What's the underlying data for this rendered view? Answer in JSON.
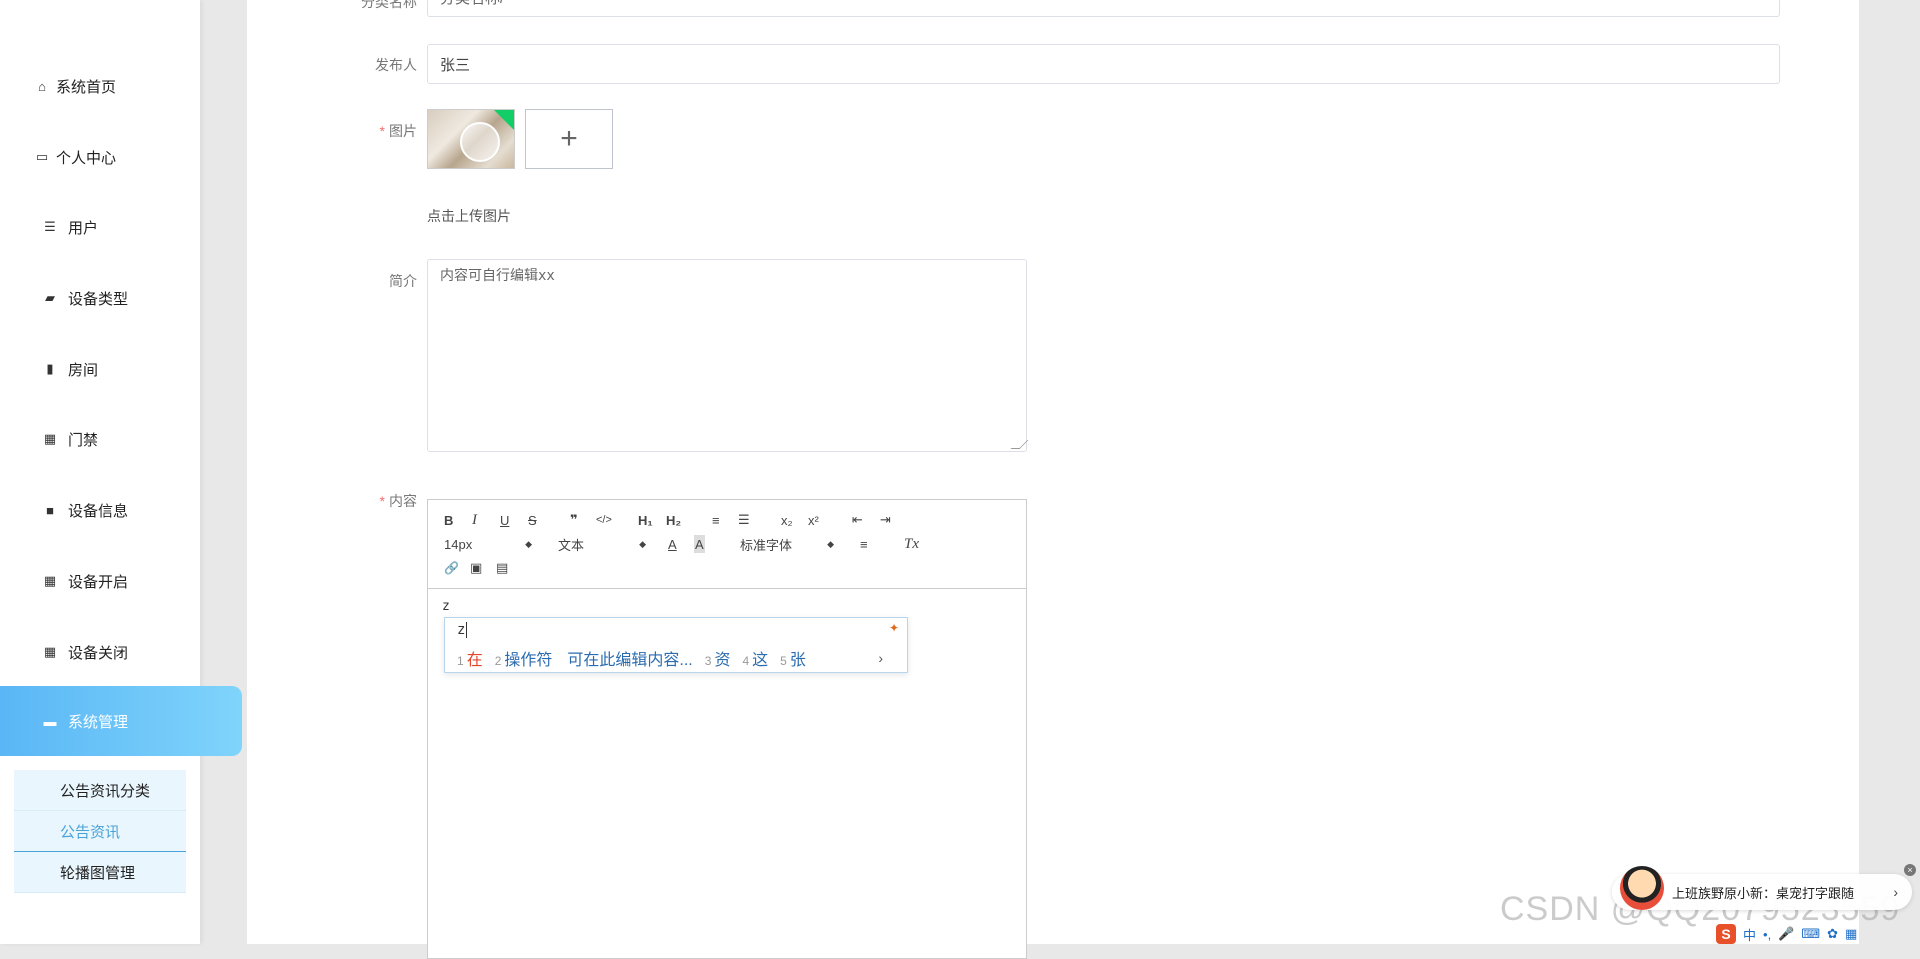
{
  "sidebar": {
    "items": [
      {
        "label": "系统首页",
        "icon": "home-icon"
      },
      {
        "label": "个人中心",
        "icon": "card-icon"
      },
      {
        "label": "用户",
        "icon": "list-icon"
      },
      {
        "label": "设备类型",
        "icon": "chair-icon"
      },
      {
        "label": "房间",
        "icon": "bar-chart-icon"
      },
      {
        "label": "门禁",
        "icon": "grid-icon"
      },
      {
        "label": "设备信息",
        "icon": "briefcase-icon"
      },
      {
        "label": "设备开启",
        "icon": "grid-icon"
      },
      {
        "label": "设备关闭",
        "icon": "grid-icon"
      },
      {
        "label": "系统管理",
        "icon": "ticket-icon"
      }
    ],
    "submenu": [
      {
        "label": "公告资讯分类"
      },
      {
        "label": "公告资讯"
      },
      {
        "label": "轮播图管理"
      }
    ]
  },
  "form": {
    "category": {
      "label": "分类名称",
      "value": "分类名称/"
    },
    "publisher": {
      "label": "发布人",
      "value": "张三"
    },
    "image": {
      "label": "图片",
      "required": "*",
      "upload_plus": "+",
      "hint": "点击上传图片"
    },
    "intro": {
      "label": "简介",
      "value": "内容可自行编辑xx"
    },
    "content": {
      "label": "内容",
      "required": "*",
      "toolbar": {
        "bold": "B",
        "italic": "I",
        "underline": "U",
        "strike": "S",
        "quote": "❞",
        "code": "</>",
        "h1": "H₁",
        "h2": "H₂",
        "ordered_list": "≡",
        "bullet_list": "☰",
        "subscript": "x₂",
        "superscript": "x²",
        "outdent": "⇤",
        "indent": "⇥",
        "size": "14px",
        "header": "文本",
        "font": "标准字体",
        "color": "A",
        "background": "A",
        "align": "≡",
        "clean": "Tx",
        "link": "🔗",
        "image": "▣",
        "video": "▤"
      },
      "typed": "z"
    }
  },
  "ime": {
    "input": "z",
    "candidates": [
      {
        "n": "1",
        "text": "在"
      },
      {
        "n": "2",
        "text": "操作符"
      },
      {
        "n": "",
        "text": "可在此编辑内容..."
      },
      {
        "n": "3",
        "text": "资"
      },
      {
        "n": "4",
        "text": "这"
      },
      {
        "n": "5",
        "text": "张"
      }
    ],
    "next": "›"
  },
  "toast": {
    "text": "上班族野原小新：桌宠打字跟随",
    "chevron": "›",
    "close": "×"
  },
  "watermark": "CSDN @QQ2079523559",
  "ime_bar": {
    "logo": "S",
    "lang": "中",
    "punct": "•,"
  }
}
